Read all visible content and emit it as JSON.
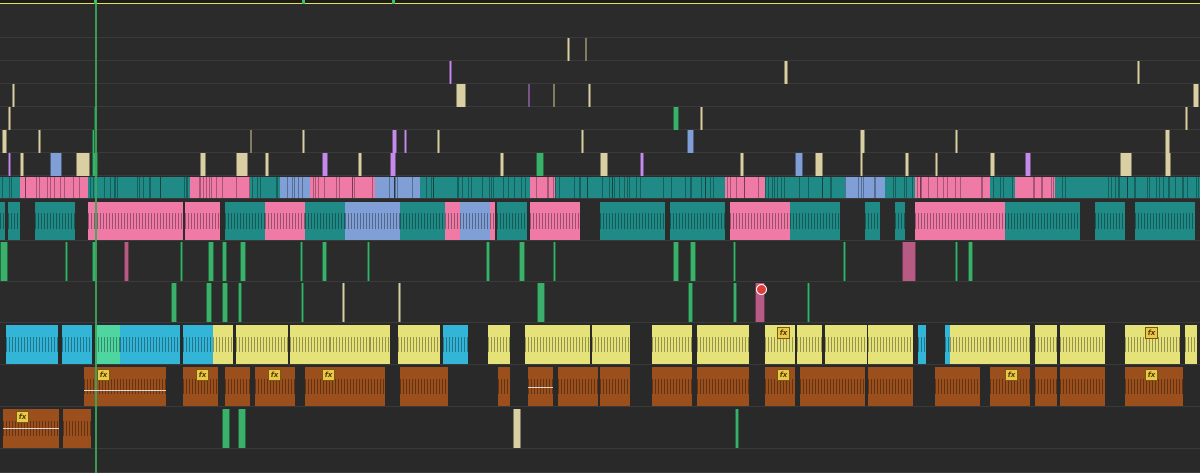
{
  "timeline": {
    "name": "editor-timeline",
    "colors": {
      "background": "#282828",
      "track_line": "#3a3a3a",
      "work_area_line": "#e8e04a",
      "beige": "#d9cfa3",
      "pink": "#ef7aa6",
      "teal": "#1f8a86",
      "lavender": "#7f9fd6",
      "violet": "#c48be8",
      "green": "#3bb06a",
      "mint": "#4fd6a0",
      "cyan": "#33b5d8",
      "yellow": "#e6e27a",
      "brown": "#9a4f1c",
      "tan": "#b4956a",
      "rose": "#b85b84"
    },
    "fx_badge_label": "fx",
    "icons": [
      "fx-badge-icon",
      "keyframe-icon",
      "marker-icon"
    ]
  }
}
